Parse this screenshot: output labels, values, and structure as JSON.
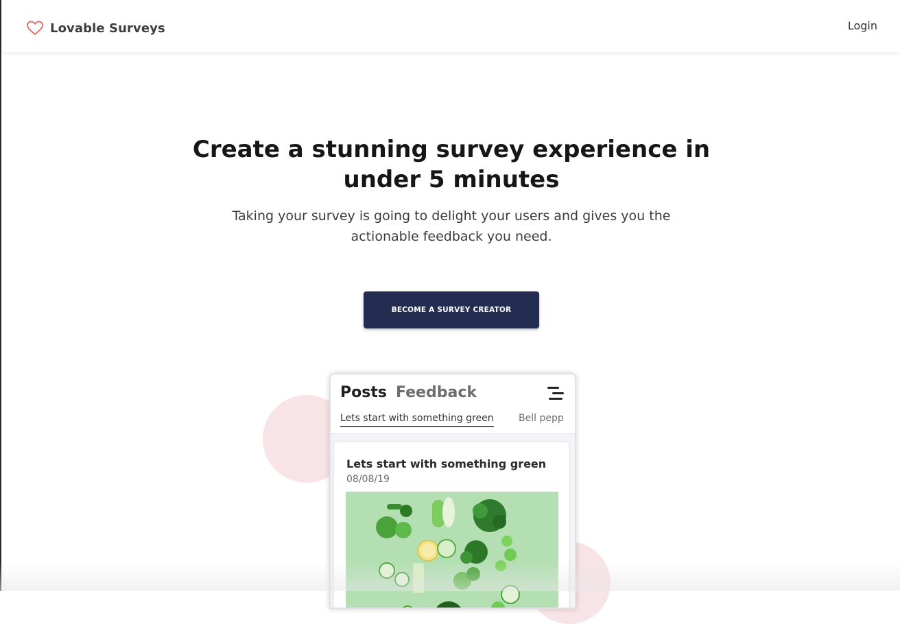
{
  "header": {
    "brand_name": "Lovable Surveys",
    "brand_icon": "heart-outline-icon",
    "login_label": "Login"
  },
  "hero": {
    "title_line1": "Create a stunning survey experience in",
    "title_line2": "under 5 minutes",
    "subtitle_line1": "Taking your survey is going to delight your users and gives you the",
    "subtitle_line2": "actionable feedback you need.",
    "cta_label": "BECOME A SURVEY CREATOR"
  },
  "preview": {
    "tabs": [
      "Posts",
      "Feedback"
    ],
    "menu_icon": "menu-icon",
    "chips": [
      "Lets start with something green",
      "Bell pepp"
    ],
    "card": {
      "title": "Lets start with something green",
      "date": "08/08/19"
    }
  },
  "colors": {
    "accent_heart": "#e8645a",
    "cta_background": "#232d52",
    "blob": "#f8e4e6",
    "photo_background": "#b4dfb3"
  }
}
